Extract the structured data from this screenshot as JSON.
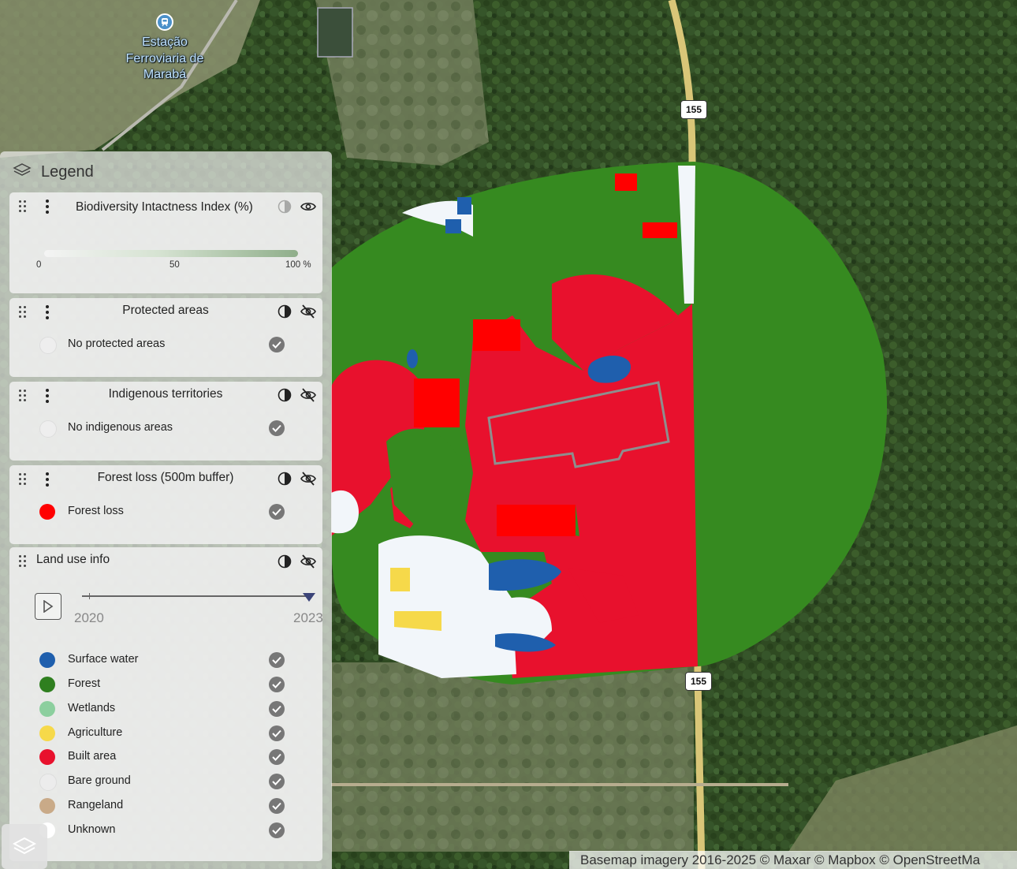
{
  "map": {
    "place_label": "Estação Ferroviaria de Marabá",
    "road_shields": [
      "155",
      "155"
    ],
    "attribution": "Basemap imagery 2016-2025 © Maxar © Mapbox © OpenStreetMa"
  },
  "legend": {
    "title": "Legend",
    "layers": [
      {
        "title": "Biodiversity Intactness Index (%)",
        "visible": true,
        "gradient_ticks": [
          "0",
          "50",
          "100 %"
        ],
        "gradient_colors": [
          "#f4f4f4",
          "#8fae8a"
        ]
      },
      {
        "title": "Protected areas",
        "visible": false,
        "items": [
          {
            "label": "No protected areas",
            "color": "#eeeeee"
          }
        ]
      },
      {
        "title": "Indigenous territories",
        "visible": false,
        "items": [
          {
            "label": "No indigenous areas",
            "color": "#eeeeee"
          }
        ]
      },
      {
        "title": "Forest loss (500m buffer)",
        "visible": false,
        "items": [
          {
            "label": "Forest loss",
            "color": "#ff0000"
          }
        ]
      },
      {
        "title": "Land use info",
        "visible": false,
        "timeline": {
          "start_year": "2020",
          "end_year": "2023"
        },
        "items": [
          {
            "label": "Surface water",
            "color": "#1f5fad"
          },
          {
            "label": "Forest",
            "color": "#2f7f1f"
          },
          {
            "label": "Wetlands",
            "color": "#8ccf9e"
          },
          {
            "label": "Agriculture",
            "color": "#f6d94a"
          },
          {
            "label": "Built area",
            "color": "#e8112d"
          },
          {
            "label": "Bare ground",
            "color": "#ececec"
          },
          {
            "label": "Rangeland",
            "color": "#c9aa88"
          },
          {
            "label": "Unknown",
            "color": "#ffffff"
          }
        ]
      }
    ]
  }
}
